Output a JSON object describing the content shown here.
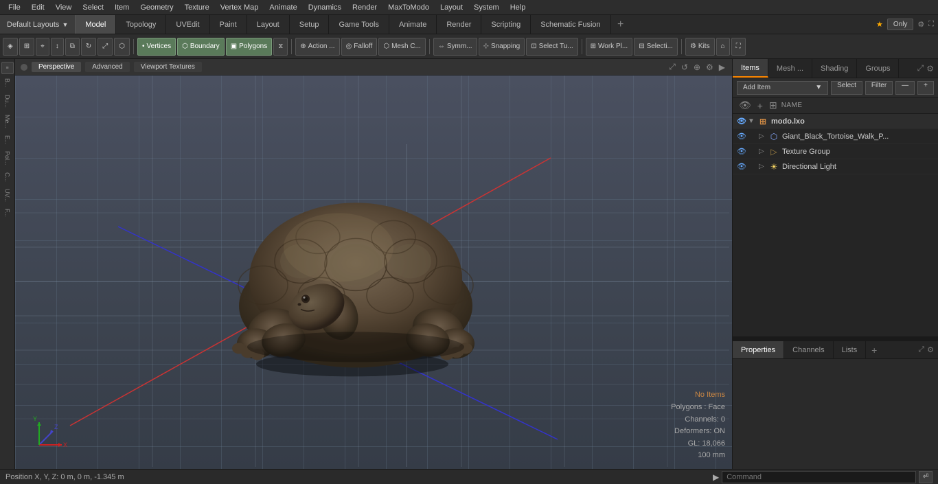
{
  "menubar": {
    "items": [
      "File",
      "Edit",
      "View",
      "Select",
      "Item",
      "Geometry",
      "Texture",
      "Vertex Map",
      "Animate",
      "Dynamics",
      "Render",
      "MaxToModo",
      "Layout",
      "System",
      "Help"
    ]
  },
  "tabbar": {
    "layouts_label": "Default Layouts",
    "tabs": [
      {
        "label": "Model",
        "active": true
      },
      {
        "label": "Topology"
      },
      {
        "label": "UVEdit"
      },
      {
        "label": "Paint"
      },
      {
        "label": "Layout"
      },
      {
        "label": "Setup"
      },
      {
        "label": "Game Tools"
      },
      {
        "label": "Animate"
      },
      {
        "label": "Render"
      },
      {
        "label": "Scripting"
      },
      {
        "label": "Schematic Fusion"
      }
    ],
    "right_btn": "Only",
    "add_icon": "+"
  },
  "toolbar": {
    "mode_buttons": [
      "Vertices",
      "Boundary",
      "Polygons"
    ],
    "action_label": "Action ...",
    "falloff_label": "Falloff",
    "mesh_label": "Mesh C...",
    "symm_label": "Symm...",
    "snapping_label": "Snapping",
    "select_tu_label": "Select Tu...",
    "work_pl_label": "Work Pl...",
    "selecti_label": "Selecti...",
    "kits_label": "Kits"
  },
  "viewport": {
    "tab_perspective": "Perspective",
    "tab_advanced": "Advanced",
    "tab_viewport_textures": "Viewport Textures",
    "info": {
      "no_items": "No Items",
      "polygons": "Polygons : Face",
      "channels": "Channels: 0",
      "deformers": "Deformers: ON",
      "gl": "GL: 18,066",
      "units": "100 mm"
    }
  },
  "status_bar": {
    "position_label": "Position X, Y, Z:",
    "position_value": "0 m, 0 m, -1.345 m",
    "command_placeholder": "Command"
  },
  "right_panel": {
    "tabs": [
      {
        "label": "Items",
        "active": true
      },
      {
        "label": "Mesh ..."
      },
      {
        "label": "Shading"
      },
      {
        "label": "Groups"
      }
    ],
    "add_item_label": "Add Item",
    "select_label": "Select",
    "filter_label": "Filter",
    "col_name": "Name",
    "scene_items": [
      {
        "id": "root",
        "label": "modo.lxo",
        "icon": "scene",
        "indent": 0,
        "expanded": true,
        "visible": true
      },
      {
        "id": "mesh",
        "label": "Giant_Black_Tortoise_Walk_P...",
        "icon": "mesh",
        "indent": 1,
        "visible": true
      },
      {
        "id": "texture_group",
        "label": "Texture Group",
        "icon": "folder",
        "indent": 1,
        "visible": true
      },
      {
        "id": "directional_light",
        "label": "Directional Light",
        "icon": "light",
        "indent": 1,
        "visible": true
      }
    ]
  },
  "properties_panel": {
    "tabs": [
      {
        "label": "Properties",
        "active": true
      },
      {
        "label": "Channels"
      },
      {
        "label": "Lists"
      }
    ]
  },
  "axes": {
    "origin_x": 0,
    "origin_y": 0
  }
}
